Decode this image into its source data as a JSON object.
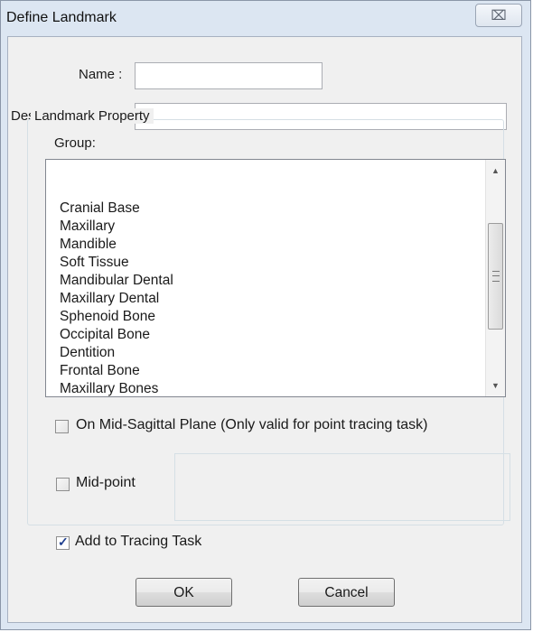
{
  "window": {
    "title": "Define Landmark",
    "close_symbol": "⌧"
  },
  "form": {
    "name_label": "Name :",
    "name_value": "",
    "description_label": "Description :",
    "description_value": ""
  },
  "landmark_property": {
    "legend": "Landmark Property",
    "group_label": "Group:",
    "groups": [
      "Cranial Base",
      "Maxillary",
      "Mandible",
      "Soft Tissue",
      "Mandibular Dental",
      "Maxillary Dental",
      "Sphenoid Bone",
      "Occipital Bone",
      "Dentition",
      "Frontal Bone",
      "Maxillary Bones"
    ],
    "mid_sagittal_label": "On Mid-Sagittal Plane (Only valid for point tracing task)",
    "mid_sagittal_checked": false,
    "mid_point_label": "Mid-point",
    "mid_point_checked": false
  },
  "add_to_tracing_label": "Add to Tracing Task",
  "add_to_tracing_checked": true,
  "buttons": {
    "ok": "OK",
    "cancel": "Cancel"
  }
}
